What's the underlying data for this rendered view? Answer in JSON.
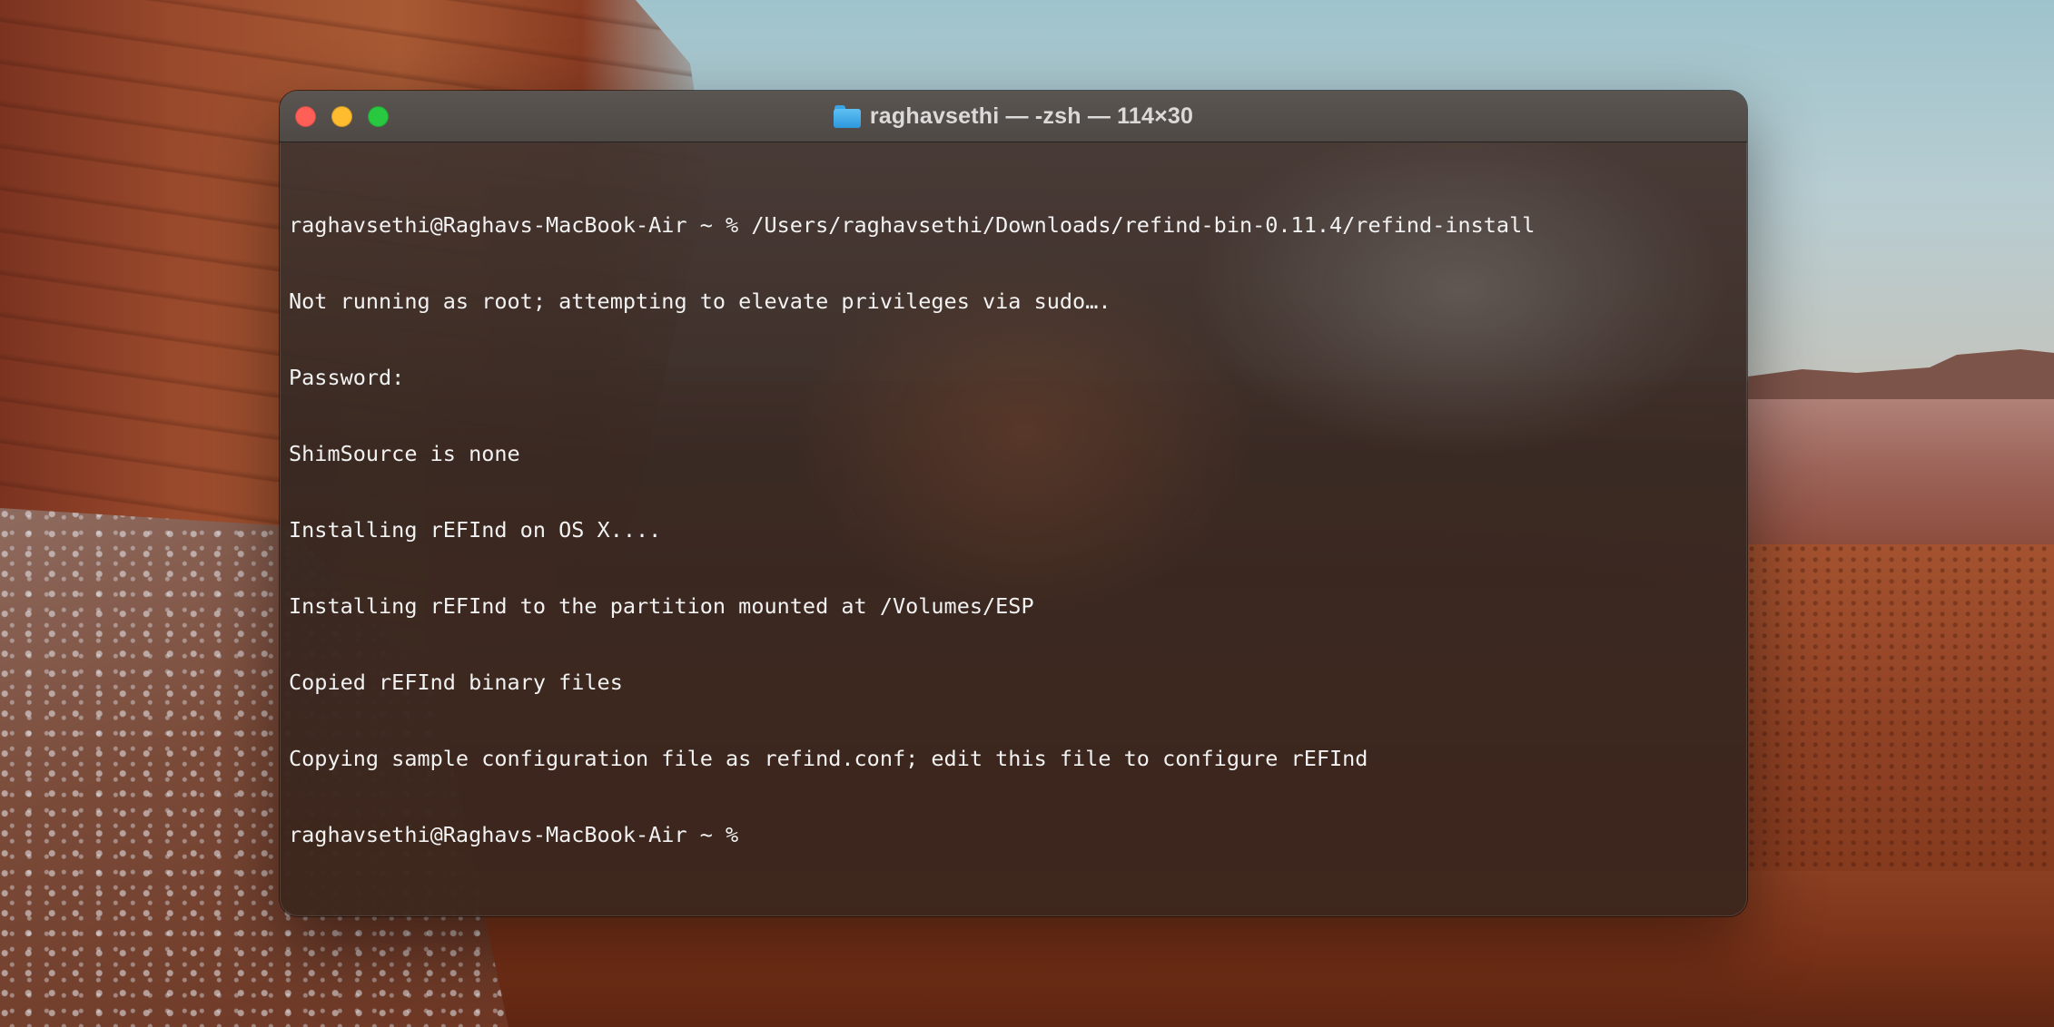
{
  "window": {
    "title": "raghavsethi — -zsh — 114×30",
    "title_icon": "folder-icon"
  },
  "terminal": {
    "lines": [
      "raghavsethi@Raghavs-MacBook-Air ~ % /Users/raghavsethi/Downloads/refind-bin-0.11.4/refind-install",
      "Not running as root; attempting to elevate privileges via sudo….",
      "Password:",
      "ShimSource is none",
      "Installing rEFInd on OS X....",
      "Installing rEFInd to the partition mounted at /Volumes/ESP",
      "Copied rEFInd binary files",
      "Copying sample configuration file as refind.conf; edit this file to configure rEFInd",
      "raghavsethi@Raghavs-MacBook-Air ~ %"
    ]
  },
  "colors": {
    "close": "#fe5f57",
    "minimize": "#febc2e",
    "zoom": "#28c840",
    "text": "#f2f2f2"
  }
}
